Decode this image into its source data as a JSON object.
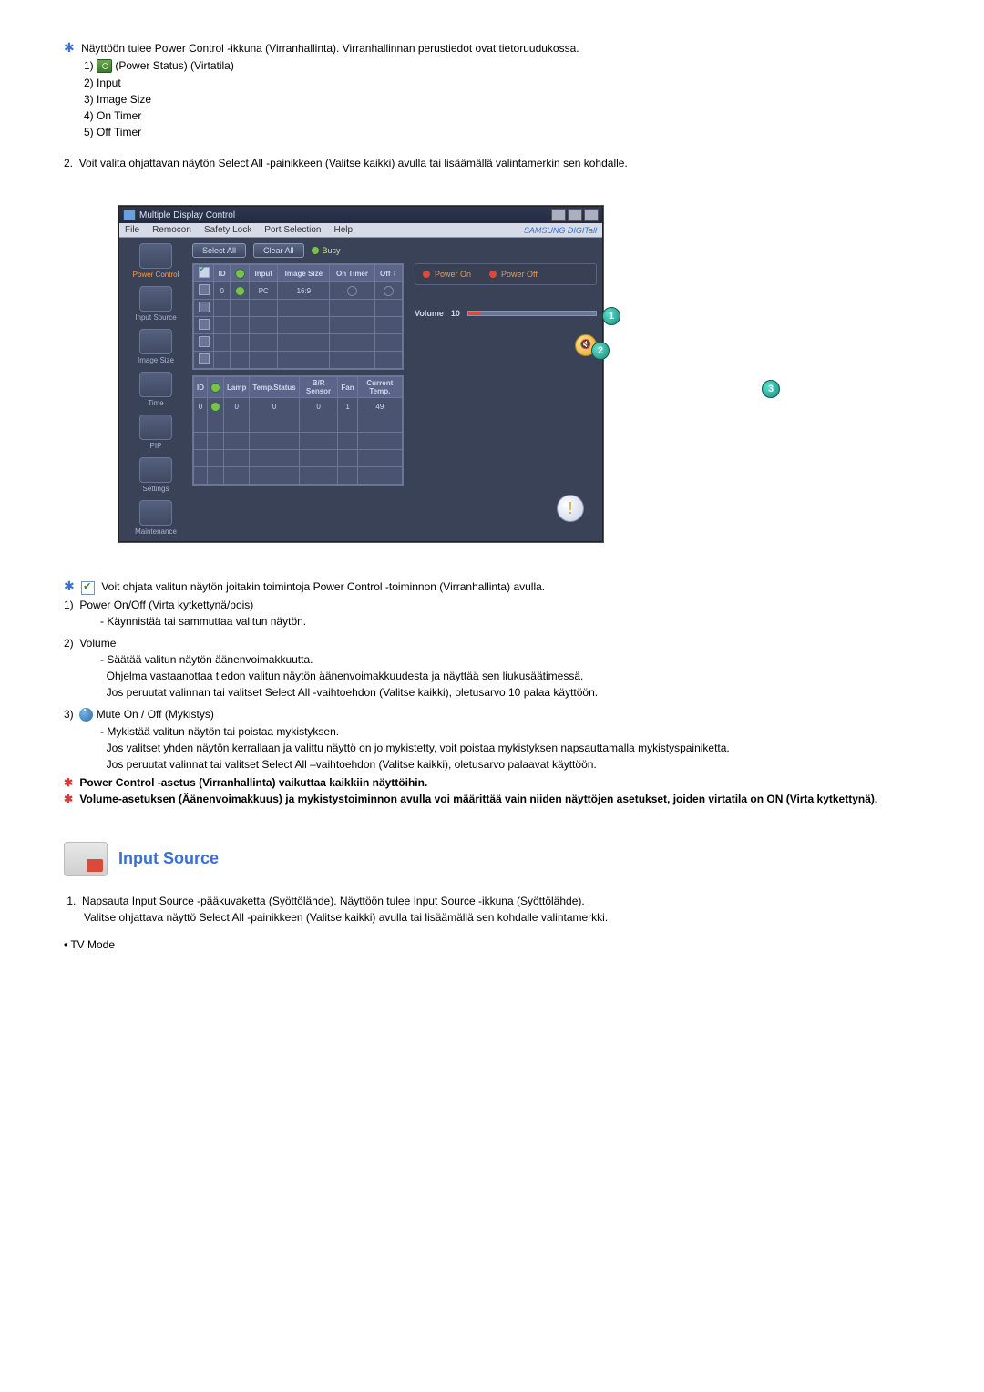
{
  "intro": {
    "line1": "Näyttöön tulee Power Control -ikkuna (Virranhallinta). Virranhallinnan perustiedot ovat tietoruudukossa.",
    "items": [
      "1)      (Power Status) (Virtatila)",
      "2) Input",
      "3) Image Size",
      "4) On Timer",
      "5) Off Timer"
    ],
    "line2_num": "2.",
    "line2": "Voit valita ohjattavan näytön Select All -painikkeen (Valitse kaikki) avulla tai lisäämällä valintamerkin sen kohdalle."
  },
  "shot": {
    "title": "Multiple Display Control",
    "menu": [
      "File",
      "Remocon",
      "Safety Lock",
      "Port Selection",
      "Help"
    ],
    "brand": "SAMSUNG DIGITall",
    "sidebar": [
      {
        "label": "Power Control",
        "active": true
      },
      {
        "label": "Input Source"
      },
      {
        "label": "Image Size"
      },
      {
        "label": "Time"
      },
      {
        "label": "PIP"
      },
      {
        "label": "Settings"
      },
      {
        "label": "Maintenance"
      }
    ],
    "select_all": "Select All",
    "clear_all": "Clear All",
    "busy": "Busy",
    "grid1": {
      "headers": [
        "",
        "ID",
        "",
        "Input",
        "Image Size",
        "On Timer",
        "Off T"
      ],
      "row": [
        "",
        "0",
        "",
        "PC",
        "16:9",
        "",
        ""
      ]
    },
    "grid2": {
      "headers": [
        "ID",
        "",
        "Lamp",
        "Temp.Status",
        "B/R Sensor",
        "Fan",
        "Current Temp."
      ],
      "row": [
        "0",
        "",
        "0",
        "0",
        "0",
        "1",
        "49"
      ]
    },
    "power_on": "Power On",
    "power_off": "Power Off",
    "volume_lbl": "Volume",
    "volume_val": "10",
    "callouts": [
      "1",
      "2",
      "3"
    ]
  },
  "body": {
    "lead": "Voit ohjata valitun näytön joitakin toimintoja Power Control -toiminnon (Virranhallinta) avulla.",
    "sec1_h": "Power On/Off (Virta kytkettynä/pois)",
    "sec1_b": "- Käynnistää tai sammuttaa valitun näytön.",
    "sec2_h": "Volume",
    "sec2_b1": "- Säätää valitun näytön äänenvoimakkuutta.",
    "sec2_b2": "Ohjelma vastaanottaa tiedon valitun näytön äänenvoimakkuudesta ja näyttää sen liukusäätimessä.",
    "sec2_b3": "Jos peruutat valinnan tai valitset Select All -vaihtoehdon (Valitse kaikki), oletusarvo 10 palaa käyttöön.",
    "sec3_h": "Mute On / Off (Mykistys)",
    "sec3_b1": "- Mykistää valitun näytön tai poistaa mykistyksen.",
    "sec3_b2": "Jos valitset yhden näytön kerrallaan ja valittu näyttö on jo mykistetty, voit poistaa mykistyksen napsauttamalla mykistyspainiketta.",
    "sec3_b3": "Jos peruutat valinnat tai valitset Select All –vaihtoehdon (Valitse kaikki), oletusarvo palaavat käyttöön.",
    "note1": "Power Control -asetus (Virranhallinta) vaikuttaa kaikkiin näyttöihin.",
    "note2": "Volume-asetuksen (Äänenvoimakkuus) ja mykistystoiminnon avulla voi määrittää vain niiden näyttöjen asetukset, joiden virtatila on ON (Virta kytkettynä)."
  },
  "section2": {
    "title": "Input Source",
    "p1_num": "1.",
    "p1a": "Napsauta Input Source -pääkuvaketta (Syöttölähde). Näyttöön tulee Input Source -ikkuna (Syöttölähde).",
    "p1b": "Valitse ohjattava näyttö Select All -painikkeen (Valitse kaikki) avulla tai lisäämällä sen kohdalle valintamerkki.",
    "tv": "• TV Mode"
  }
}
